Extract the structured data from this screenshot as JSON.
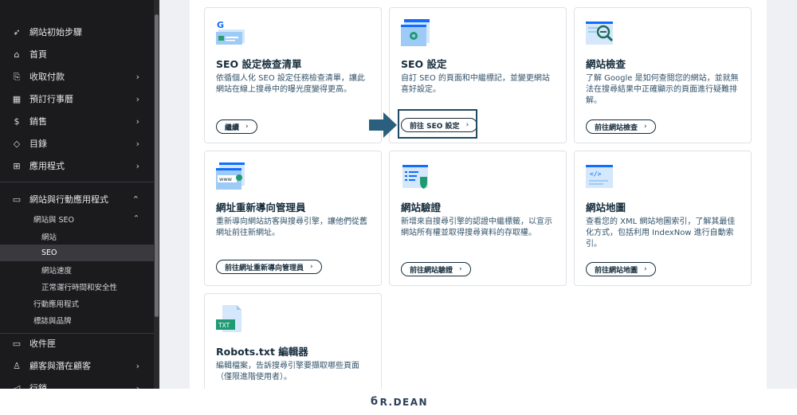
{
  "sidebar": {
    "items": [
      {
        "label": "網站初始步驟",
        "icon": "rocket-icon",
        "chevron": ""
      },
      {
        "label": "首頁",
        "icon": "home-icon",
        "chevron": ""
      },
      {
        "label": "收取付款",
        "icon": "payment-icon",
        "chevron": "›"
      },
      {
        "label": "預訂行事曆",
        "icon": "calendar-icon",
        "chevron": "›"
      },
      {
        "label": "銷售",
        "icon": "dollar-icon",
        "chevron": "›"
      },
      {
        "label": "目錄",
        "icon": "catalog-icon",
        "chevron": "›"
      },
      {
        "label": "應用程式",
        "icon": "apps-icon",
        "chevron": "›"
      },
      {
        "label": "網站與行動應用程式",
        "icon": "site-icon",
        "chevron": "⌃"
      }
    ],
    "subgroup": {
      "label": "網站與 SEO",
      "chevron": "⌃"
    },
    "sub_items": [
      "網站",
      "SEO",
      "網站速度",
      "正常運行時間和安全性"
    ],
    "more_items": [
      "行動應用程式",
      "標誌與品牌"
    ],
    "bottom_items": [
      {
        "label": "收件匣",
        "icon": "inbox-icon",
        "chevron": ""
      },
      {
        "label": "顧客與潛在顧客",
        "icon": "contacts-icon",
        "chevron": "›"
      },
      {
        "label": "行銷",
        "icon": "marketing-icon",
        "chevron": "›"
      }
    ]
  },
  "cards": [
    {
      "title": "SEO 設定檢查清單",
      "desc": "依循個人化 SEO 設定任務檢查清單，讓此網站在線上搜尋中的曝光度變得更高。",
      "button": "繼續",
      "icon": "seo-checklist-icon",
      "icon_letter": "G"
    },
    {
      "title": "SEO 設定",
      "desc": "自訂 SEO 的頁面和中繼標記，並變更網站喜好設定。",
      "button": "前往 SEO 設定",
      "icon": "seo-settings-icon"
    },
    {
      "title": "網站檢查",
      "desc": "了解 Google 是如何查閱您的網站，並就無法在搜尋結果中正確顯示的頁面進行疑難排解。",
      "button": "前往網站檢查",
      "icon": "site-inspection-icon"
    },
    {
      "title": "網址重新導向管理員",
      "desc": "重新導向網站訪客與搜尋引擎，讓他們從舊網址前往新網址。",
      "button": "前往網址重新導向管理員",
      "icon": "url-redirect-icon",
      "icon_text": "www"
    },
    {
      "title": "網站驗證",
      "desc": "新增來自搜尋引擎的認證中繼標籤，以宣示網站所有權並取得搜尋資料的存取權。",
      "button": "前往網站驗證",
      "icon": "site-verification-icon"
    },
    {
      "title": "網站地圖",
      "desc": "查看您的 XML 網站地圖索引，了解其最佳化方式，包括利用 IndexNow 進行自動索引。",
      "button": "前往網站地圖",
      "icon": "sitemap-icon",
      "icon_text": "</>"
    },
    {
      "title": "Robots.txt 編輯器",
      "desc": "編輯檔案，告訴搜尋引擎要擷取哪些頁面（僅限進階使用者）。",
      "button": "",
      "icon": "robots-txt-icon",
      "icon_text": "TXT"
    }
  ],
  "colors": {
    "accent": "#3899ec",
    "dark": "#162d3d",
    "highlight": "#1e4a63",
    "sidebar_bg": "#1b1b1e",
    "arrow": "#2b5f7e"
  },
  "footer": {
    "logo": "R.DEAN",
    "logo_mark": "б"
  }
}
